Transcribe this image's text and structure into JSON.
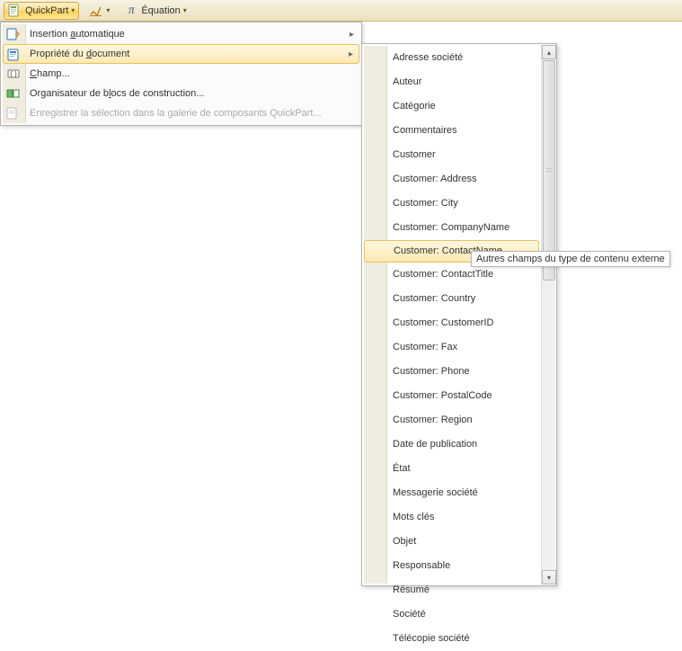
{
  "ribbon": {
    "quickpart": {
      "label": "QuickPart"
    },
    "equation": {
      "label": "Équation"
    }
  },
  "menu": {
    "items": [
      {
        "label": "Insertion automatique",
        "underline_index": 10,
        "has_submenu": true,
        "highlight": false,
        "disabled": false
      },
      {
        "label": "Propriété du document",
        "underline_index": 13,
        "has_submenu": true,
        "highlight": true,
        "disabled": false
      },
      {
        "label": "Champ...",
        "underline_index": 0,
        "has_submenu": false,
        "highlight": false,
        "disabled": false
      },
      {
        "label": "Organisateur de blocs de construction...",
        "underline_index": 17,
        "has_submenu": false,
        "highlight": false,
        "disabled": false
      },
      {
        "label": "Enregistrer la sélection dans la galerie de composants QuickPart...",
        "underline_index": -1,
        "has_submenu": false,
        "highlight": false,
        "disabled": true
      }
    ]
  },
  "submenu": {
    "items": [
      "Adresse société",
      "Auteur",
      "Catégorie",
      "Commentaires",
      "Customer",
      "Customer: Address",
      "Customer: City",
      "Customer: CompanyName",
      "Customer: ContactName",
      "Customer: ContactTitle",
      "Customer: Country",
      "Customer: CustomerID",
      "Customer: Fax",
      "Customer: Phone",
      "Customer: PostalCode",
      "Customer: Region",
      "Date de publication",
      "État",
      "Messagerie société",
      "Mots clés",
      "Objet",
      "Responsable",
      "Résumé",
      "Société",
      "Télécopie société"
    ],
    "highlight_index": 8
  },
  "tooltip": {
    "text": "Autres champs du type de contenu externe"
  },
  "colors": {
    "highlight_top": "#fef6e0",
    "highlight_bot": "#fde9b2",
    "highlight_border": "#e8c15a",
    "ribbon_active_border": "#d9a43c"
  }
}
